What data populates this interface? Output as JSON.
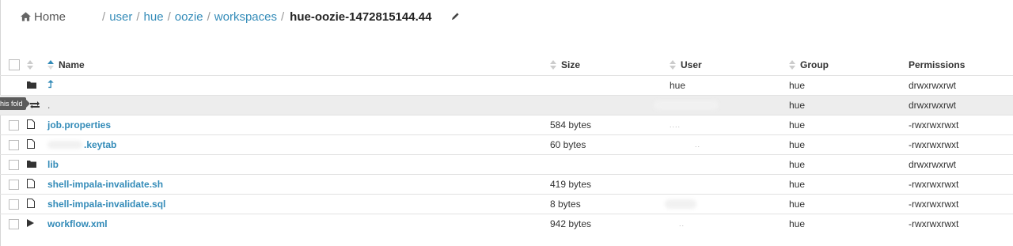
{
  "breadcrumb": {
    "home_label": "Home",
    "separator": "/",
    "segments": [
      "user",
      "hue",
      "oozie",
      "workspaces"
    ],
    "current": "hue-oozie-1472815144.44"
  },
  "table": {
    "headers": {
      "name": "Name",
      "size": "Size",
      "user": "User",
      "group": "Group",
      "permissions": "Permissions"
    },
    "rows": [
      {
        "type": "folder",
        "name": "",
        "size": "",
        "user": "hue",
        "group": "hue",
        "permissions": "drwxrwxrwt"
      },
      {
        "type": "folder",
        "name": ".",
        "size": "",
        "user": "",
        "group": "hue",
        "permissions": "drwxrwxrwt"
      },
      {
        "type": "file",
        "name": "job.properties",
        "size": "584 bytes",
        "user": "....",
        "group": "hue",
        "permissions": "-rwxrwxrwxt"
      },
      {
        "type": "file",
        "name": ".keytab",
        "size": "60 bytes",
        "user": "..",
        "group": "hue",
        "permissions": "-rwxrwxrwxt"
      },
      {
        "type": "folder",
        "name": "lib",
        "size": "",
        "user": "",
        "group": "hue",
        "permissions": "drwxrwxrwt"
      },
      {
        "type": "file",
        "name": "shell-impala-invalidate.sh",
        "size": "419 bytes",
        "user": "",
        "group": "hue",
        "permissions": "-rwxrwxrwxt"
      },
      {
        "type": "file",
        "name": "shell-impala-invalidate.sql",
        "size": "8 bytes",
        "user": "",
        "group": "hue",
        "permissions": "-rwxrwxrwxt"
      },
      {
        "type": "workflow",
        "name": "workflow.xml",
        "size": "942 bytes",
        "user": "..",
        "group": "hue",
        "permissions": "-rwxrwxrwxt"
      }
    ]
  },
  "tooltip": {
    "text": "his fold"
  },
  "colors": {
    "link": "#338bb8",
    "row_highlight": "#ededed",
    "tooltip_bg": "#5b5b5b"
  }
}
